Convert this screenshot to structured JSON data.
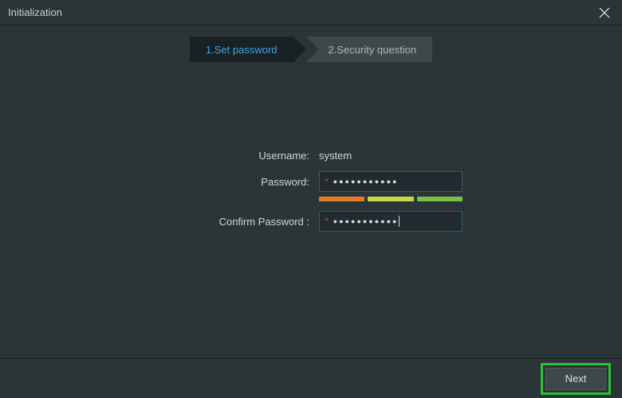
{
  "window": {
    "title": "Initialization"
  },
  "steps": {
    "active": {
      "label": "1.Set password"
    },
    "inactive": {
      "label": "2.Security question"
    }
  },
  "form": {
    "username_label": "Username:",
    "username_value": "system",
    "password_label": "Password:",
    "password_masked": "●●●●●●●●●●●",
    "confirm_label": "Confirm Password :",
    "confirm_masked": "●●●●●●●●●●●"
  },
  "footer": {
    "next_label": "Next"
  }
}
